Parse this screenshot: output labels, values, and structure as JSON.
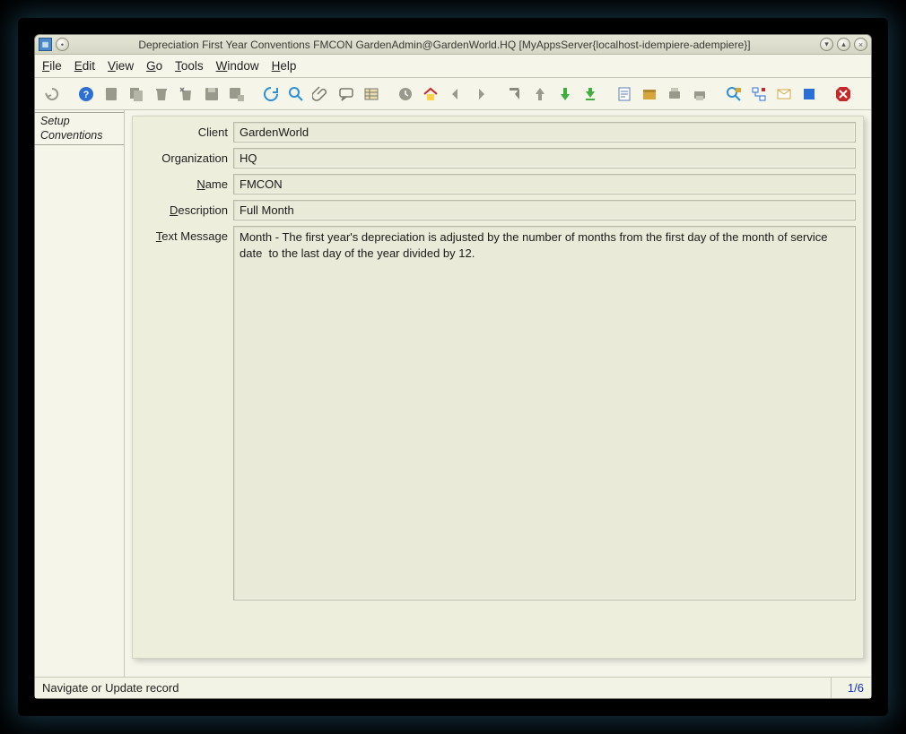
{
  "titlebar": {
    "title": "Depreciation First Year Conventions   FMCON  GardenAdmin@GardenWorld.HQ [MyAppsServer{localhost-idempiere-adempiere}]"
  },
  "menu": {
    "file": "File",
    "edit": "Edit",
    "view": "View",
    "go": "Go",
    "tools": "Tools",
    "window": "Window",
    "help": "Help"
  },
  "toolbar_icons": {
    "undo": "undo",
    "help": "help",
    "new": "new",
    "copy": "copy",
    "delete": "delete",
    "delete_sel": "delete-selection",
    "save": "save",
    "save_new": "save-create-new",
    "refresh": "refresh",
    "find": "find",
    "attachment": "attachment",
    "chat": "chat",
    "grid": "grid-toggle",
    "history": "history",
    "home": "home",
    "parent": "parent-record",
    "detail": "detail-record",
    "first": "first-record",
    "prev": "previous-record",
    "next": "next-record",
    "last": "last-record",
    "report": "report",
    "archive": "archive",
    "print_preview": "print-preview",
    "print": "print",
    "zoom": "zoom-across",
    "workflow": "active-workflows",
    "requests": "requests",
    "product": "product-info",
    "end": "end"
  },
  "sidebar": {
    "tab1_line1": "Setup",
    "tab1_line2": "Conventions"
  },
  "form": {
    "client_label": "Client",
    "client_value": "GardenWorld",
    "org_label": "Organization",
    "org_value": "HQ",
    "name_label_pre": "",
    "name_label_u": "N",
    "name_label_post": "ame",
    "name_value": "FMCON",
    "desc_label_pre": "",
    "desc_label_u": "D",
    "desc_label_post": "escription",
    "desc_value": "Full Month",
    "text_label_pre": "",
    "text_label_u": "T",
    "text_label_post": "ext Message",
    "text_value": "Month - The first year's depreciation is adjusted by the number of months from the first day of the month of service date  to the last day of the year divided by 12."
  },
  "status": {
    "left": "Navigate or Update record",
    "right": "1/6"
  }
}
